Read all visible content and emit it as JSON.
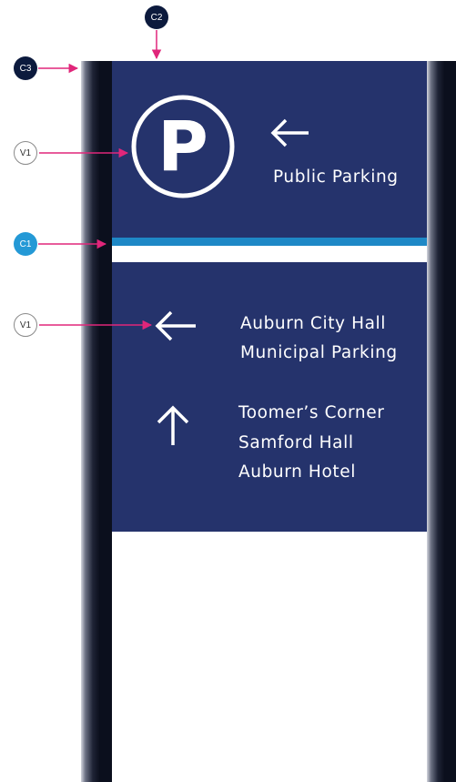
{
  "callouts": {
    "c2": "C2",
    "c3": "C3",
    "v1_top": "V1",
    "c1": "C1",
    "v1_bottom": "V1"
  },
  "sign": {
    "top_panel": {
      "icon": "parking-p-icon",
      "arrow": "left-arrow-icon",
      "label": "Public Parking"
    },
    "bottom_panel": {
      "left_arrow": "left-arrow-icon",
      "left_destinations": [
        "Auburn City Hall",
        "Municipal Parking"
      ],
      "up_arrow": "up-arrow-icon",
      "up_destinations": [
        "Toomer’s Corner",
        "Samford Hall",
        "Auburn Hotel"
      ]
    }
  },
  "colors": {
    "panel_navy": "#25336c",
    "accent_band_blue": "#1e88c6",
    "post_dark": "#0b0f1d",
    "callout_pink": "#e0267a",
    "badge_dark": "#0c1a3d",
    "badge_blue": "#2499d6"
  }
}
